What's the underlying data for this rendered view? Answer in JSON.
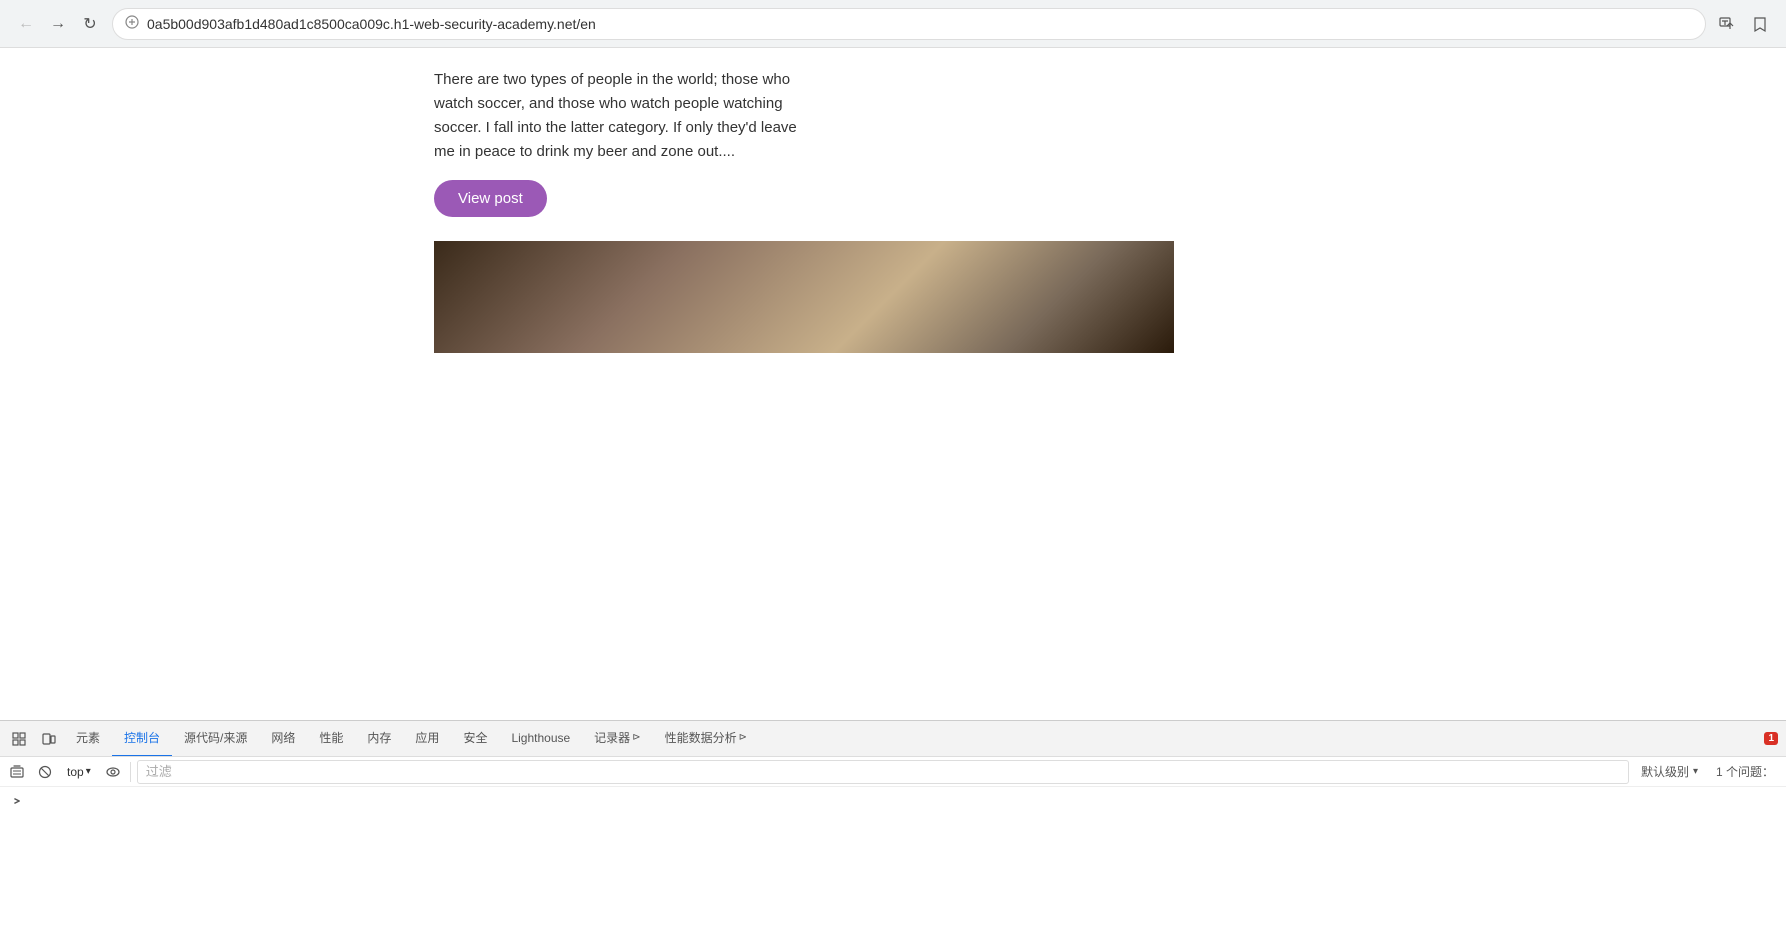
{
  "browser": {
    "url": "0a5b00d903afb1d480ad1c8500ca009c.h1-web-security-academy.net/en",
    "back_btn": "←",
    "forward_btn": "→",
    "refresh_btn": "↻",
    "translate_icon": "🌐",
    "bookmark_icon": "☆"
  },
  "page": {
    "blog_text": "There are two types of people in the world; those who watch soccer, and those who watch people watching soccer. I fall into the latter category. If only they'd leave me in peace to drink my beer and zone out....",
    "view_post_label": "View post"
  },
  "devtools": {
    "tabs": [
      {
        "label": "元素",
        "active": false
      },
      {
        "label": "控制台",
        "active": true
      },
      {
        "label": "源代码/来源",
        "active": false
      },
      {
        "label": "网络",
        "active": false
      },
      {
        "label": "性能",
        "active": false
      },
      {
        "label": "内存",
        "active": false
      },
      {
        "label": "应用",
        "active": false
      },
      {
        "label": "安全",
        "active": false
      },
      {
        "label": "Lighthouse",
        "active": false
      },
      {
        "label": "记录器",
        "active": false
      },
      {
        "label": "性能数据分析",
        "active": false
      }
    ],
    "toolbar": {
      "top_label": "top",
      "filter_placeholder": "过滤",
      "default_level_label": "默认级别",
      "issues_label": "1 个问题："
    },
    "error_count": "1"
  }
}
